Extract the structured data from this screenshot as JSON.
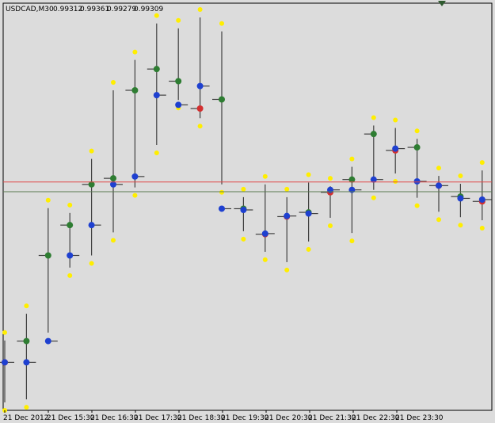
{
  "window": {
    "symbol": "USDCAD,M30",
    "open": "0.99312",
    "high": "0.99361",
    "low": "0.99279",
    "close": "0.99309"
  },
  "colors": {
    "background": "#dcdcdc",
    "grid_frame": "#000000",
    "wick": "#404040",
    "open_tick": "#404040",
    "up_open_dot": "#2e7d32",
    "down_open_dot": "#d32f2f",
    "close_dot": "#1e40d0",
    "extreme_dot": "#ffee00",
    "ask_line": "#e04848",
    "bid_line": "#5a7a50"
  },
  "chart_data": {
    "type": "candlestick",
    "x": [
      "21 Dec 2012 14:30",
      "21 Dec 2012 15:00",
      "21 Dec 2012 15:30",
      "21 Dec 2012 16:00",
      "21 Dec 2012 16:30",
      "21 Dec 2012 17:00",
      "21 Dec 2012 17:30",
      "21 Dec 2012 18:00",
      "21 Dec 2012 18:30",
      "21 Dec 2012 19:00",
      "21 Dec 2012 19:30",
      "21 Dec 2012 20:00",
      "21 Dec 2012 20:30",
      "21 Dec 2012 21:00",
      "21 Dec 2012 21:30",
      "21 Dec 2012 22:00",
      "21 Dec 2012 22:30",
      "21 Dec 2012 23:00",
      "21 Dec 2012 23:30"
    ],
    "x_tick_labels": [
      "21 Dec 2012",
      "21 Dec 15:30",
      "21 Dec 16:30",
      "21 Dec 17:30",
      "21 Dec 18:30",
      "21 Dec 19:30",
      "21 Dec 20:30",
      "21 Dec 21:30",
      "21 Dec 22:30",
      "21 Dec 23:30"
    ],
    "ylim": [
      0.99,
      1.0
    ],
    "series": [
      {
        "ohlc": [
          {
            "o": 0.99418,
            "h": 0.99454,
            "l": 0.99352,
            "c": 0.99418
          },
          {
            "o": 0.99453,
            "h": 0.99498,
            "l": 0.99357,
            "c": 0.99418
          },
          {
            "o": 0.99594,
            "h": 0.99672,
            "l": 0.99467,
            "c": 0.99453
          },
          {
            "o": 0.99644,
            "h": 0.99664,
            "l": 0.99574,
            "c": 0.99594
          },
          {
            "o": 0.99711,
            "h": 0.99753,
            "l": 0.99594,
            "c": 0.99644
          },
          {
            "o": 0.99721,
            "h": 0.99866,
            "l": 0.99632,
            "c": 0.99711
          },
          {
            "o": 0.99866,
            "h": 0.99916,
            "l": 0.99706,
            "c": 0.99724
          },
          {
            "o": 0.99901,
            "h": 0.99976,
            "l": 0.99776,
            "c": 0.99858
          },
          {
            "o": 0.99881,
            "h": 0.99968,
            "l": 0.9985,
            "c": 0.99842
          },
          {
            "o": 0.99836,
            "h": 0.99986,
            "l": 0.9982,
            "c": 0.99873
          },
          {
            "o": 0.99851,
            "h": 0.99963,
            "l": 0.99711,
            "c": 0.99671
          },
          {
            "o": 0.99671,
            "h": 0.9969,
            "l": 0.99634,
            "c": 0.99669
          },
          {
            "o": 0.99629,
            "h": 0.99711,
            "l": 0.996,
            "c": 0.9963
          },
          {
            "o": 0.99658,
            "h": 0.9969,
            "l": 0.99583,
            "c": 0.99659
          },
          {
            "o": 0.99665,
            "h": 0.99714,
            "l": 0.99617,
            "c": 0.99663
          },
          {
            "o": 0.99698,
            "h": 0.99708,
            "l": 0.99656,
            "c": 0.99702
          },
          {
            "o": 0.99719,
            "h": 0.9974,
            "l": 0.99631,
            "c": 0.99702
          },
          {
            "o": 0.99794,
            "h": 0.99808,
            "l": 0.99702,
            "c": 0.99719
          },
          {
            "o": 0.99767,
            "h": 0.99804,
            "l": 0.99729,
            "c": 0.9977
          },
          {
            "o": 0.99772,
            "h": 0.99786,
            "l": 0.99689,
            "c": 0.99716
          },
          {
            "o": 0.99709,
            "h": 0.99725,
            "l": 0.99666,
            "c": 0.99709
          },
          {
            "o": 0.99691,
            "h": 0.99712,
            "l": 0.99657,
            "c": 0.99688
          },
          {
            "o": 0.99683,
            "h": 0.99734,
            "l": 0.99652,
            "c": 0.99686
          }
        ]
      }
    ],
    "ask_level": 0.99715,
    "bid_level": 0.99699
  }
}
